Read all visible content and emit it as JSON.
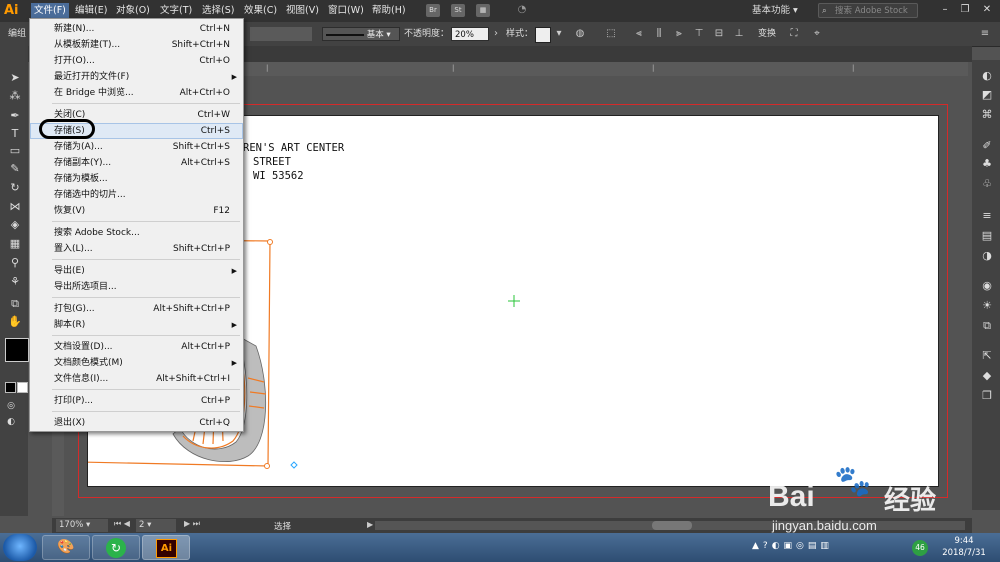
{
  "menubar": {
    "logo": "Ai",
    "items": [
      "文件(F)",
      "编辑(E)",
      "对象(O)",
      "文字(T)",
      "选择(S)",
      "效果(C)",
      "视图(V)",
      "窗口(W)",
      "帮助(H)"
    ],
    "br": "Br",
    "st": "St",
    "workspace": "基本功能",
    "stock_search_placeholder": "搜索 Adobe Stock"
  },
  "controlbar": {
    "left_label": "编组",
    "stroke_profile": "基本",
    "opacity_label": "不透明度：",
    "opacity_value": "20%",
    "style_label": "样式：",
    "transform_label": "变换"
  },
  "file_menu": {
    "items": [
      {
        "label": "新建(N)...",
        "shortcut": "Ctrl+N"
      },
      {
        "label": "从模板新建(T)...",
        "shortcut": "Shift+Ctrl+N"
      },
      {
        "label": "打开(O)...",
        "shortcut": "Ctrl+O"
      },
      {
        "label": "最近打开的文件(F)",
        "shortcut": "",
        "submenu": true
      },
      {
        "label": "在 Bridge 中浏览...",
        "shortcut": "Alt+Ctrl+O"
      },
      {
        "label": "关闭(C)",
        "shortcut": "Ctrl+W"
      },
      {
        "label": "存储(S)",
        "shortcut": "Ctrl+S",
        "highlighted": true
      },
      {
        "label": "存储为(A)...",
        "shortcut": "Shift+Ctrl+S"
      },
      {
        "label": "存储副本(Y)...",
        "shortcut": "Alt+Ctrl+S"
      },
      {
        "label": "存储为模板...",
        "shortcut": ""
      },
      {
        "label": "存储选中的切片...",
        "shortcut": ""
      },
      {
        "label": "恢复(V)",
        "shortcut": "F12"
      },
      {
        "label": "搜索 Adobe Stock...",
        "shortcut": ""
      },
      {
        "label": "置入(L)...",
        "shortcut": "Shift+Ctrl+P"
      },
      {
        "label": "导出(E)",
        "shortcut": "",
        "submenu": true
      },
      {
        "label": "导出所选项目...",
        "shortcut": ""
      },
      {
        "label": "打包(G)...",
        "shortcut": "Alt+Shift+Ctrl+P"
      },
      {
        "label": "脚本(R)",
        "shortcut": "",
        "submenu": true
      },
      {
        "label": "文档设置(D)...",
        "shortcut": "Alt+Ctrl+P"
      },
      {
        "label": "文档颜色模式(M)",
        "shortcut": "",
        "submenu": true
      },
      {
        "label": "文件信息(I)...",
        "shortcut": "Alt+Shift+Ctrl+I"
      },
      {
        "label": "打印(P)...",
        "shortcut": "Ctrl+P"
      },
      {
        "label": "退出(X)",
        "shortcut": "Ctrl+Q"
      }
    ]
  },
  "canvas": {
    "address_line1": "REN'S ART CENTER",
    "address_line2": "STREET",
    "address_line3": "WI 53562"
  },
  "statusbar": {
    "zoom": "170%",
    "artboard": "2",
    "tool": "选择"
  },
  "taskbar": {
    "time": "9:44",
    "date": "2018/7/31",
    "badge": "46",
    "ai_label": "Ai"
  },
  "watermark": {
    "brand": "Bai",
    "brand2": "经验",
    "url": "jingyan.baidu.com"
  }
}
